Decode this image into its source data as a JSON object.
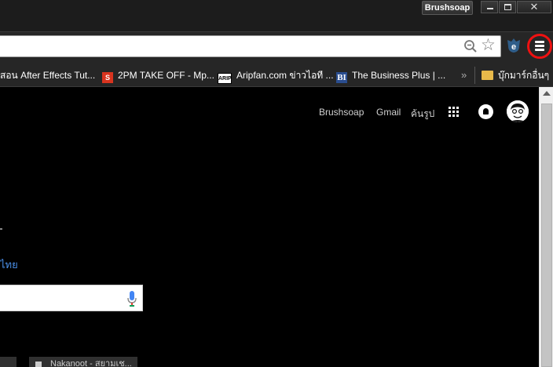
{
  "titlebar": {
    "profile_name": "Brushsoap",
    "close_glyph": "✕"
  },
  "toolbar": {
    "icons": [
      "zoom-icon",
      "star-icon",
      "extension-icon",
      "chrome-menu-icon"
    ],
    "highlight_color": "#ee1111"
  },
  "bookmarks": {
    "items": [
      {
        "label": "สอน After Effects Tut...",
        "icon": "none"
      },
      {
        "label": "2PM TAKE OFF - Mp...",
        "icon": "S"
      },
      {
        "label": "Aripfan.com ข่าวไอที ...",
        "icon": "ARIP"
      },
      {
        "label": "The Business Plus | ...",
        "icon": "BI"
      }
    ],
    "more": "»",
    "folder_label": "บุ๊กมาร์กอื่นๆ"
  },
  "content": {
    "top_links": [
      "Brushsoap",
      "Gmail",
      "ค้นรูป"
    ],
    "language_link": "ไทย",
    "tile_label": "Nakanoot - สยามเช..."
  },
  "colors": {
    "chrome_dark": "#262626",
    "link_blue": "#4a8fe8"
  }
}
